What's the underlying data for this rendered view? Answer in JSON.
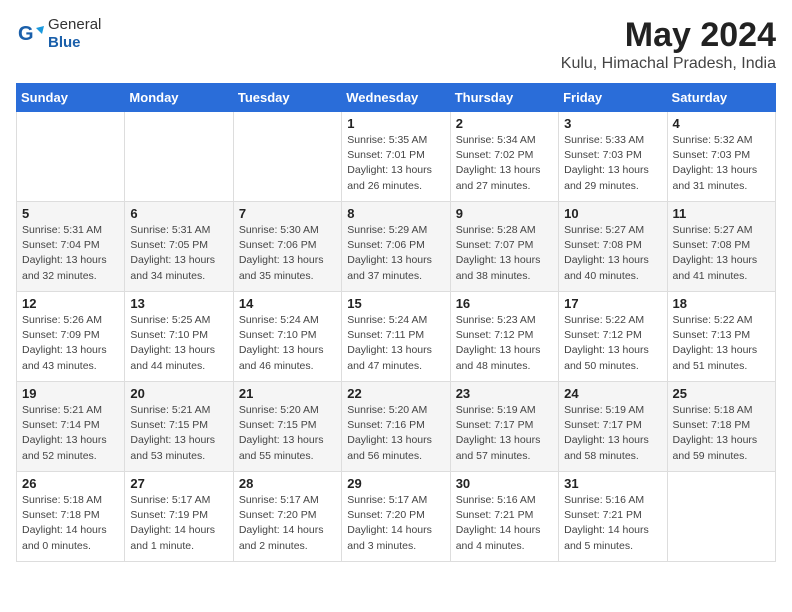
{
  "logo": {
    "general": "General",
    "blue": "Blue"
  },
  "title": "May 2024",
  "subtitle": "Kulu, Himachal Pradesh, India",
  "headers": [
    "Sunday",
    "Monday",
    "Tuesday",
    "Wednesday",
    "Thursday",
    "Friday",
    "Saturday"
  ],
  "weeks": [
    [
      {
        "day": "",
        "info": ""
      },
      {
        "day": "",
        "info": ""
      },
      {
        "day": "",
        "info": ""
      },
      {
        "day": "1",
        "info": "Sunrise: 5:35 AM\nSunset: 7:01 PM\nDaylight: 13 hours\nand 26 minutes."
      },
      {
        "day": "2",
        "info": "Sunrise: 5:34 AM\nSunset: 7:02 PM\nDaylight: 13 hours\nand 27 minutes."
      },
      {
        "day": "3",
        "info": "Sunrise: 5:33 AM\nSunset: 7:03 PM\nDaylight: 13 hours\nand 29 minutes."
      },
      {
        "day": "4",
        "info": "Sunrise: 5:32 AM\nSunset: 7:03 PM\nDaylight: 13 hours\nand 31 minutes."
      }
    ],
    [
      {
        "day": "5",
        "info": "Sunrise: 5:31 AM\nSunset: 7:04 PM\nDaylight: 13 hours\nand 32 minutes."
      },
      {
        "day": "6",
        "info": "Sunrise: 5:31 AM\nSunset: 7:05 PM\nDaylight: 13 hours\nand 34 minutes."
      },
      {
        "day": "7",
        "info": "Sunrise: 5:30 AM\nSunset: 7:06 PM\nDaylight: 13 hours\nand 35 minutes."
      },
      {
        "day": "8",
        "info": "Sunrise: 5:29 AM\nSunset: 7:06 PM\nDaylight: 13 hours\nand 37 minutes."
      },
      {
        "day": "9",
        "info": "Sunrise: 5:28 AM\nSunset: 7:07 PM\nDaylight: 13 hours\nand 38 minutes."
      },
      {
        "day": "10",
        "info": "Sunrise: 5:27 AM\nSunset: 7:08 PM\nDaylight: 13 hours\nand 40 minutes."
      },
      {
        "day": "11",
        "info": "Sunrise: 5:27 AM\nSunset: 7:08 PM\nDaylight: 13 hours\nand 41 minutes."
      }
    ],
    [
      {
        "day": "12",
        "info": "Sunrise: 5:26 AM\nSunset: 7:09 PM\nDaylight: 13 hours\nand 43 minutes."
      },
      {
        "day": "13",
        "info": "Sunrise: 5:25 AM\nSunset: 7:10 PM\nDaylight: 13 hours\nand 44 minutes."
      },
      {
        "day": "14",
        "info": "Sunrise: 5:24 AM\nSunset: 7:10 PM\nDaylight: 13 hours\nand 46 minutes."
      },
      {
        "day": "15",
        "info": "Sunrise: 5:24 AM\nSunset: 7:11 PM\nDaylight: 13 hours\nand 47 minutes."
      },
      {
        "day": "16",
        "info": "Sunrise: 5:23 AM\nSunset: 7:12 PM\nDaylight: 13 hours\nand 48 minutes."
      },
      {
        "day": "17",
        "info": "Sunrise: 5:22 AM\nSunset: 7:12 PM\nDaylight: 13 hours\nand 50 minutes."
      },
      {
        "day": "18",
        "info": "Sunrise: 5:22 AM\nSunset: 7:13 PM\nDaylight: 13 hours\nand 51 minutes."
      }
    ],
    [
      {
        "day": "19",
        "info": "Sunrise: 5:21 AM\nSunset: 7:14 PM\nDaylight: 13 hours\nand 52 minutes."
      },
      {
        "day": "20",
        "info": "Sunrise: 5:21 AM\nSunset: 7:15 PM\nDaylight: 13 hours\nand 53 minutes."
      },
      {
        "day": "21",
        "info": "Sunrise: 5:20 AM\nSunset: 7:15 PM\nDaylight: 13 hours\nand 55 minutes."
      },
      {
        "day": "22",
        "info": "Sunrise: 5:20 AM\nSunset: 7:16 PM\nDaylight: 13 hours\nand 56 minutes."
      },
      {
        "day": "23",
        "info": "Sunrise: 5:19 AM\nSunset: 7:17 PM\nDaylight: 13 hours\nand 57 minutes."
      },
      {
        "day": "24",
        "info": "Sunrise: 5:19 AM\nSunset: 7:17 PM\nDaylight: 13 hours\nand 58 minutes."
      },
      {
        "day": "25",
        "info": "Sunrise: 5:18 AM\nSunset: 7:18 PM\nDaylight: 13 hours\nand 59 minutes."
      }
    ],
    [
      {
        "day": "26",
        "info": "Sunrise: 5:18 AM\nSunset: 7:18 PM\nDaylight: 14 hours\nand 0 minutes."
      },
      {
        "day": "27",
        "info": "Sunrise: 5:17 AM\nSunset: 7:19 PM\nDaylight: 14 hours\nand 1 minute."
      },
      {
        "day": "28",
        "info": "Sunrise: 5:17 AM\nSunset: 7:20 PM\nDaylight: 14 hours\nand 2 minutes."
      },
      {
        "day": "29",
        "info": "Sunrise: 5:17 AM\nSunset: 7:20 PM\nDaylight: 14 hours\nand 3 minutes."
      },
      {
        "day": "30",
        "info": "Sunrise: 5:16 AM\nSunset: 7:21 PM\nDaylight: 14 hours\nand 4 minutes."
      },
      {
        "day": "31",
        "info": "Sunrise: 5:16 AM\nSunset: 7:21 PM\nDaylight: 14 hours\nand 5 minutes."
      },
      {
        "day": "",
        "info": ""
      }
    ]
  ]
}
